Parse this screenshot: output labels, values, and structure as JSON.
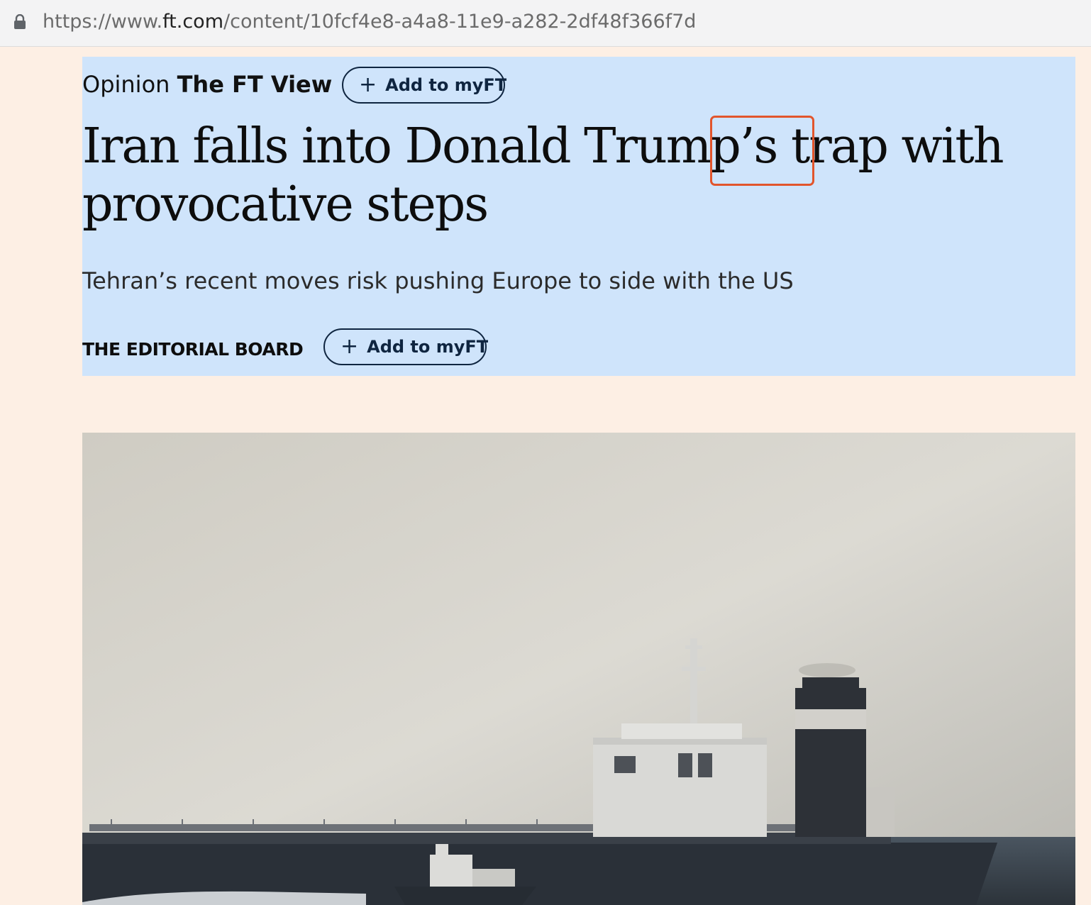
{
  "browser": {
    "url_scheme": "https://www.",
    "url_host": "ft.com",
    "url_path": "/content/10fcf4e8-a4a8-11e9-a282-2df48f366f7d"
  },
  "article": {
    "kicker_section": "Opinion",
    "kicker_series": "The FT View",
    "add_to_myft_label": "Add to myFT",
    "headline_before": "Iran falls into Donald Trump’s ",
    "headline_highlight": "trap",
    "headline_after": " with provocative steps",
    "standfirst": "Tehran’s recent moves risk pushing Europe to side with the US",
    "byline": "THE EDITORIAL BOARD",
    "byline_follow_label": "Add to myFT"
  },
  "colors": {
    "page_background": "#fdefe4",
    "selection_highlight": "#cfe4fb",
    "annotation_box": "#e2552c",
    "button_text": "#0f2540"
  },
  "icons": {
    "lock": "lock-icon",
    "plus": "plus-icon"
  }
}
